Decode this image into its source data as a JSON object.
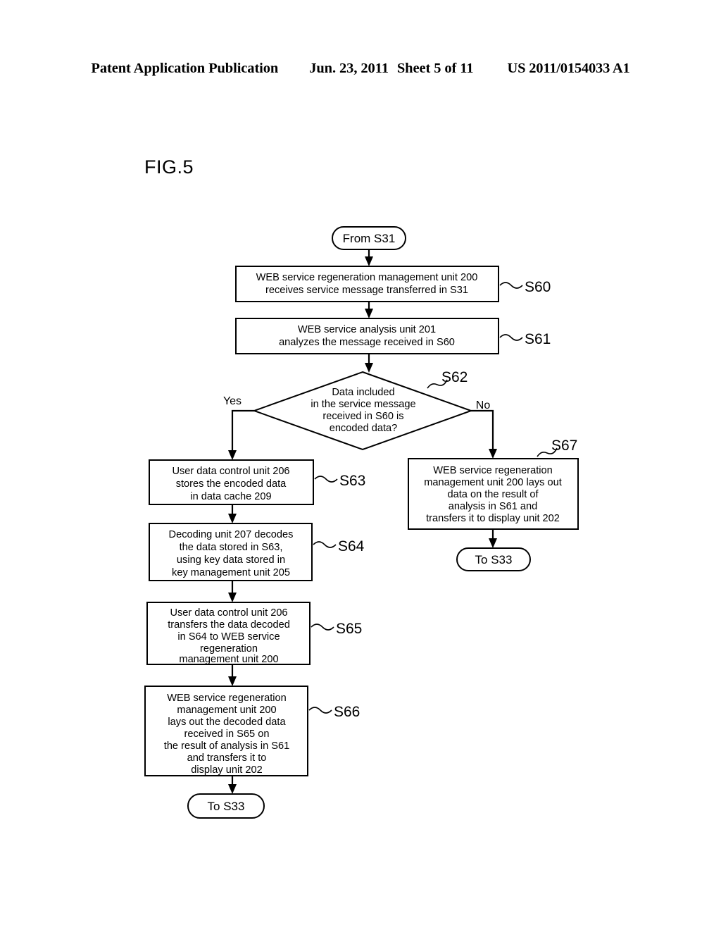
{
  "header": {
    "publication": "Patent Application Publication",
    "date": "Jun. 23, 2011",
    "sheet": "Sheet 5 of 11",
    "number": "US 2011/0154033 A1"
  },
  "figure": {
    "label": "FIG.5"
  },
  "flowchart": {
    "start_terminator": "From S31",
    "end_terminator_left": "To S33",
    "end_terminator_right": "To S33",
    "branch_yes": "Yes",
    "branch_no": "No",
    "nodes": [
      {
        "id": "S60",
        "step": "S60",
        "type": "process",
        "lines": [
          "WEB service regeneration management unit 200",
          "receives service message transferred in S31"
        ]
      },
      {
        "id": "S61",
        "step": "S61",
        "type": "process",
        "lines": [
          "WEB service analysis unit 201",
          "analyzes the message received in S60"
        ]
      },
      {
        "id": "S62",
        "step": "S62",
        "type": "decision",
        "lines": [
          "Data included",
          "in the service message",
          "received in S60 is",
          "encoded data?"
        ]
      },
      {
        "id": "S63",
        "step": "S63",
        "type": "process",
        "lines": [
          "User data control unit 206",
          "stores the encoded data",
          "in data cache 209"
        ]
      },
      {
        "id": "S64",
        "step": "S64",
        "type": "process",
        "lines": [
          "Decoding unit 207 decodes",
          "the data stored in S63,",
          "using key data stored in",
          "key management unit 205"
        ]
      },
      {
        "id": "S65",
        "step": "S65",
        "type": "process",
        "lines": [
          "User data control unit 206",
          "transfers the data decoded",
          "in S64 to WEB service",
          "regeneration",
          "management unit 200"
        ]
      },
      {
        "id": "S66",
        "step": "S66",
        "type": "process",
        "lines": [
          "WEB service regeneration",
          "management unit 200",
          "lays out the decoded data",
          "received in S65 on",
          "the result  of analysis in S61",
          "and  transfers it to",
          "display unit 202"
        ]
      },
      {
        "id": "S67",
        "step": "S67",
        "type": "process",
        "lines": [
          "WEB service regeneration",
          "management unit 200 lays out",
          "data on the result of",
          "analysis in S61 and",
          "transfers it to display unit 202"
        ]
      }
    ]
  }
}
